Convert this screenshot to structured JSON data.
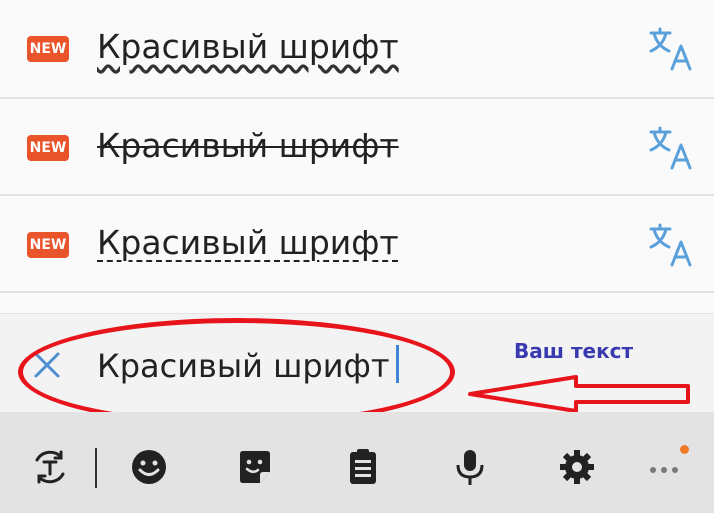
{
  "list": {
    "items": [
      {
        "badge": "NEW",
        "text": "Красивый шрифт",
        "style": "bubble"
      },
      {
        "badge": "NEW",
        "text": "Красивый шрифт",
        "style": "strike"
      },
      {
        "badge": "NEW",
        "text": "Красивый шрифт",
        "style": "dashed"
      }
    ]
  },
  "input": {
    "value": "Красивый шрифт"
  },
  "annotation": {
    "note": "Ваш текст",
    "color": "#e8141b"
  },
  "toolbar": {
    "icons": [
      "text-style-icon",
      "emoji-icon",
      "sticker-icon",
      "clipboard-icon",
      "microphone-icon",
      "gear-icon",
      "more-icon"
    ]
  },
  "colors": {
    "badge": "#e9542b",
    "accent": "#3f86d6",
    "note": "#3a3ab0",
    "notification_dot": "#f07a26"
  }
}
